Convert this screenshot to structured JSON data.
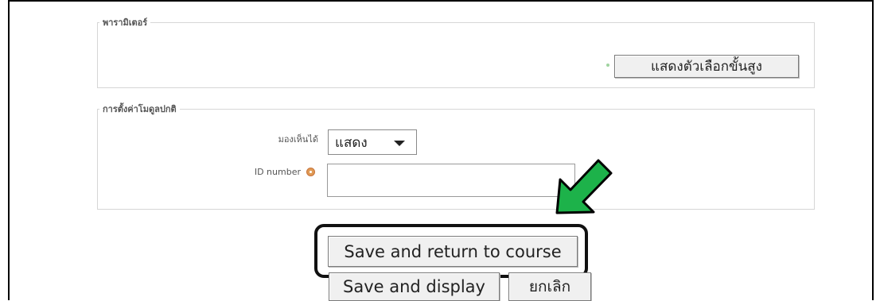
{
  "params_section": {
    "legend": "พารามิเตอร์",
    "advanced_button": "แสดงตัวเลือกขั้นสูง"
  },
  "common_section": {
    "legend": "การตั้งค่าโมดูลปกติ",
    "visible_label": "มองเห็นได้",
    "visible_value": "แสดง",
    "idnumber_label": "ID number",
    "idnumber_value": ""
  },
  "actions": {
    "save_return": "Save and return to course",
    "save_display": "Save and display",
    "cancel": "ยกเลิก"
  },
  "annotation": {
    "arrow_color": "#1db24a",
    "highlight_color": "#111111"
  },
  "icons": {
    "help": "help-icon",
    "dropdown": "chevron-down-icon"
  }
}
